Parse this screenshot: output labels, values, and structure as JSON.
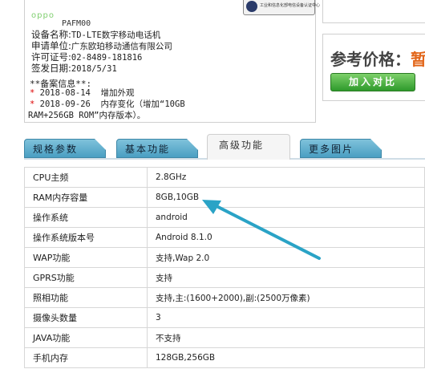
{
  "info": {
    "brand": "oppo",
    "model": "PAFM00",
    "stamp_text": "工业和信息化部电信设备认证中心",
    "fields": [
      {
        "label": "设备名称:",
        "value": "TD-LTE数字移动电话机"
      },
      {
        "label": "申请单位:",
        "value": "广东欧珀移动通信有限公司"
      },
      {
        "label": "许可证号:",
        "value": "02-8489-181816"
      },
      {
        "label": "签发日期:",
        "value": "2018/5/31"
      }
    ],
    "filing_title": "**备案信息**:",
    "entries": [
      {
        "date": "2018-08-14",
        "text": "增加外观"
      },
      {
        "date": "2018-09-26",
        "text": "内存变化（增加“10GB"
      }
    ],
    "entry_continuation": "RAM+256GB ROM”内存版本）。"
  },
  "price": {
    "label": "参考价格：",
    "value": "暂",
    "compare_button": "加入对比"
  },
  "tabs": [
    "规格参数",
    "基本功能",
    "高级功能",
    "更多图片"
  ],
  "active_tab": "高级功能",
  "specs": [
    {
      "key": "CPU主频",
      "value": "2.8GHz"
    },
    {
      "key": "RAM内存容量",
      "value": "8GB,10GB"
    },
    {
      "key": "操作系统",
      "value": "android"
    },
    {
      "key": "操作系统版本号",
      "value": "Android 8.1.0"
    },
    {
      "key": "WAP功能",
      "value": "支持,Wap 2.0"
    },
    {
      "key": "GPRS功能",
      "value": "支持"
    },
    {
      "key": "照相功能",
      "value": "支持,主:(1600+2000),副:(2500万像素)"
    },
    {
      "key": "摄像头数量",
      "value": "3"
    },
    {
      "key": "JAVA功能",
      "value": "不支持"
    },
    {
      "key": "手机内存",
      "value": "128GB,256GB"
    }
  ],
  "colors": {
    "accent_arrow": "#2aa3c6",
    "price_value": "#e2661a",
    "compare_button": "#3fa83a",
    "tab_blue": "#5aaed0"
  }
}
